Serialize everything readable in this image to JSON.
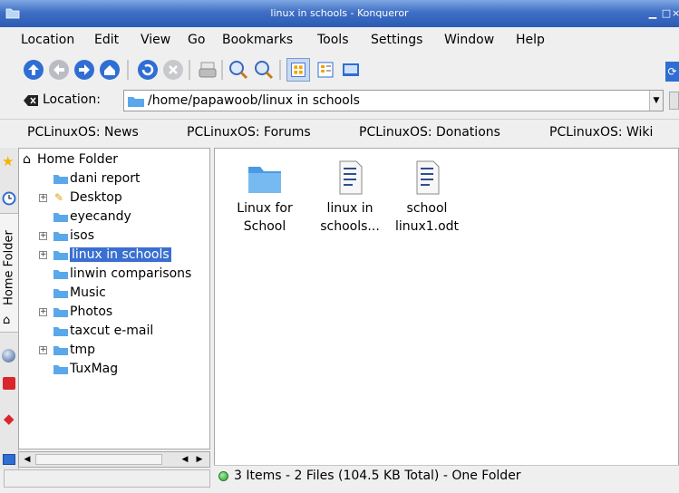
{
  "window": {
    "title": "linux in schools - Konqueror"
  },
  "menubar": {
    "items": [
      {
        "label": "Location",
        "mnemonic": "L"
      },
      {
        "label": "Edit",
        "mnemonic": "E"
      },
      {
        "label": "View",
        "mnemonic": "V"
      },
      {
        "label": "Go",
        "mnemonic": "G"
      },
      {
        "label": "Bookmarks",
        "mnemonic": "B"
      },
      {
        "label": "Tools",
        "mnemonic": "T"
      },
      {
        "label": "Settings",
        "mnemonic": "S"
      },
      {
        "label": "Window",
        "mnemonic": "W"
      },
      {
        "label": "Help",
        "mnemonic": "H"
      }
    ]
  },
  "toolbar": {
    "icons": [
      "up-arrow-icon",
      "back-arrow-icon",
      "forward-arrow-icon",
      "home-icon",
      "reload-icon",
      "stop-icon",
      "print-icon",
      "zoom-in-icon",
      "zoom-out-icon",
      "icon-view-icon",
      "detail-view-icon",
      "preview-icon"
    ]
  },
  "locationbar": {
    "label": "Location:",
    "value": "/home/papawoob/linux in schools"
  },
  "bookmarks": {
    "items": [
      "PCLinuxOS: News",
      "PCLinuxOS: Forums",
      "PCLinuxOS: Donations",
      "PCLinuxOS: Wiki"
    ]
  },
  "sidebar": {
    "vertical_tab": "Home Folder",
    "tree": {
      "root": "Home Folder",
      "items": [
        {
          "label": "dani report",
          "expandable": false
        },
        {
          "label": "Desktop",
          "expandable": true
        },
        {
          "label": "eyecandy",
          "expandable": false
        },
        {
          "label": "isos",
          "expandable": true
        },
        {
          "label": "linux in schools",
          "expandable": true,
          "selected": true
        },
        {
          "label": "linwin comparisons",
          "expandable": false
        },
        {
          "label": "Music",
          "expandable": false
        },
        {
          "label": "Photos",
          "expandable": true
        },
        {
          "label": "taxcut e-mail",
          "expandable": false
        },
        {
          "label": "tmp",
          "expandable": true
        },
        {
          "label": "TuxMag",
          "expandable": false
        }
      ]
    }
  },
  "main": {
    "files": [
      {
        "line1": "Linux for",
        "line2": "School",
        "kind": "folder"
      },
      {
        "line1": "linux in",
        "line2": "schools...",
        "kind": "document"
      },
      {
        "line1": "school",
        "line2": "linux1.odt",
        "kind": "document"
      }
    ]
  },
  "statusbar": {
    "text": "3 Items - 2 Files (104.5 KB Total) - One Folder"
  },
  "colors": {
    "titlebar": "#3f6fc5",
    "selection": "#3a6fd1",
    "folder": "#5aa8ea"
  }
}
